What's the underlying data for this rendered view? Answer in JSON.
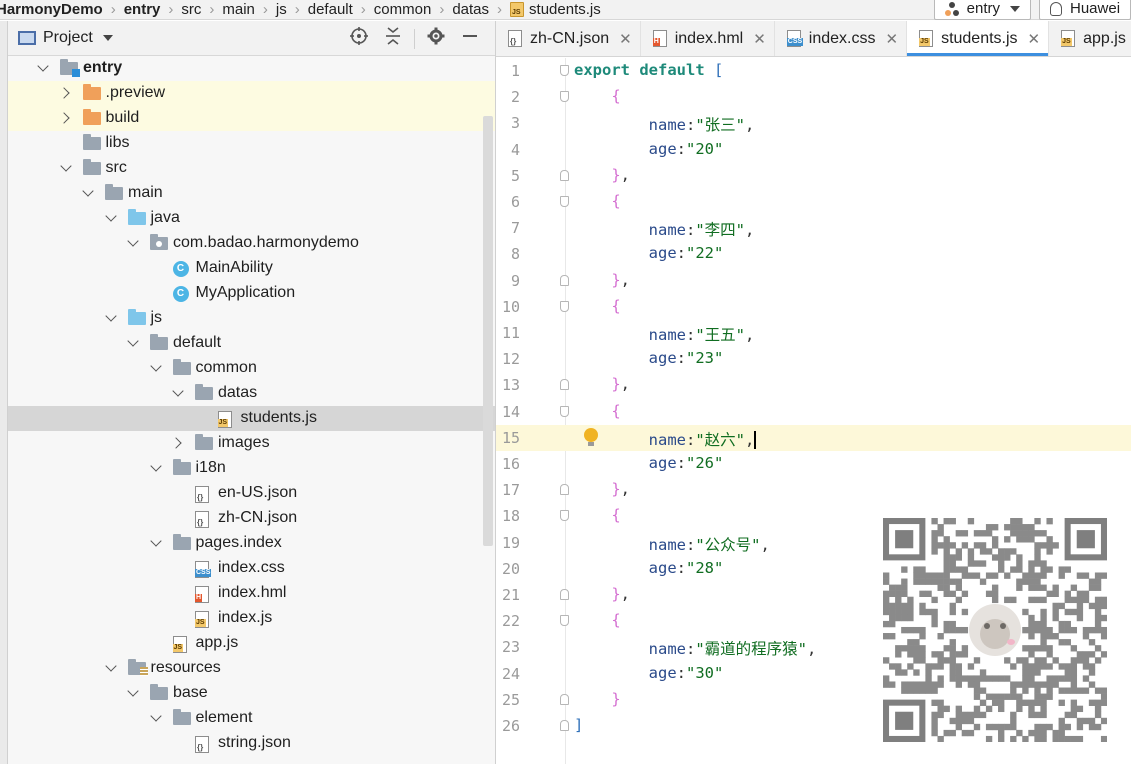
{
  "breadcrumb": {
    "items": [
      {
        "label": "HarmonyDemo",
        "bold": true
      },
      {
        "label": "entry",
        "bold": true
      },
      {
        "label": "src"
      },
      {
        "label": "main"
      },
      {
        "label": "js"
      },
      {
        "label": "default"
      },
      {
        "label": "common"
      },
      {
        "label": "datas"
      },
      {
        "label": "students.js",
        "icon": "js-file-icon"
      }
    ]
  },
  "toolbar": {
    "run_config": "entry",
    "device": "Huawei"
  },
  "project_panel": {
    "title": "Project",
    "tools": [
      "locate-icon",
      "collapse-all-icon",
      "settings-icon",
      "hide-icon"
    ]
  },
  "tree": [
    {
      "label": "entry",
      "depth": 0,
      "arrow": "down",
      "icon": "module-folder-icon",
      "bold": true
    },
    {
      "label": ".preview",
      "depth": 1,
      "arrow": "right",
      "icon": "orange-folder-icon",
      "changed": true
    },
    {
      "label": "build",
      "depth": 1,
      "arrow": "right",
      "icon": "orange-folder-icon",
      "changed": true
    },
    {
      "label": "libs",
      "depth": 1,
      "arrow": "",
      "icon": "folder-icon"
    },
    {
      "label": "src",
      "depth": 1,
      "arrow": "down",
      "icon": "folder-icon"
    },
    {
      "label": "main",
      "depth": 2,
      "arrow": "down",
      "icon": "folder-icon"
    },
    {
      "label": "java",
      "depth": 3,
      "arrow": "down",
      "icon": "blue-folder-icon"
    },
    {
      "label": "com.badao.harmonydemo",
      "depth": 4,
      "arrow": "down",
      "icon": "package-icon"
    },
    {
      "label": "MainAbility",
      "depth": 5,
      "arrow": "",
      "icon": "class-icon"
    },
    {
      "label": "MyApplication",
      "depth": 5,
      "arrow": "",
      "icon": "class-icon"
    },
    {
      "label": "js",
      "depth": 3,
      "arrow": "down",
      "icon": "blue-folder-icon"
    },
    {
      "label": "default",
      "depth": 4,
      "arrow": "down",
      "icon": "folder-icon"
    },
    {
      "label": "common",
      "depth": 5,
      "arrow": "down",
      "icon": "folder-icon"
    },
    {
      "label": "datas",
      "depth": 6,
      "arrow": "down",
      "icon": "folder-icon"
    },
    {
      "label": "students.js",
      "depth": 7,
      "arrow": "",
      "icon": "js-file-icon",
      "selected": true
    },
    {
      "label": "images",
      "depth": 6,
      "arrow": "right",
      "icon": "folder-icon"
    },
    {
      "label": "i18n",
      "depth": 5,
      "arrow": "down",
      "icon": "folder-icon"
    },
    {
      "label": "en-US.json",
      "depth": 6,
      "arrow": "",
      "icon": "json-file-icon"
    },
    {
      "label": "zh-CN.json",
      "depth": 6,
      "arrow": "",
      "icon": "json-file-icon"
    },
    {
      "label": "pages.index",
      "depth": 5,
      "arrow": "down",
      "icon": "folder-icon"
    },
    {
      "label": "index.css",
      "depth": 6,
      "arrow": "",
      "icon": "css-file-icon"
    },
    {
      "label": "index.hml",
      "depth": 6,
      "arrow": "",
      "icon": "hml-file-icon"
    },
    {
      "label": "index.js",
      "depth": 6,
      "arrow": "",
      "icon": "js-file-icon"
    },
    {
      "label": "app.js",
      "depth": 5,
      "arrow": "",
      "icon": "js-file-icon"
    },
    {
      "label": "resources",
      "depth": 3,
      "arrow": "down",
      "icon": "resources-folder-icon"
    },
    {
      "label": "base",
      "depth": 4,
      "arrow": "down",
      "icon": "folder-icon"
    },
    {
      "label": "element",
      "depth": 5,
      "arrow": "down",
      "icon": "folder-icon"
    },
    {
      "label": "string.json",
      "depth": 6,
      "arrow": "",
      "icon": "json-file-icon"
    }
  ],
  "tabs": [
    {
      "label": "zh-CN.json",
      "icon": "json-file-icon",
      "active": false,
      "closable": true
    },
    {
      "label": "index.hml",
      "icon": "hml-file-icon",
      "active": false,
      "closable": true
    },
    {
      "label": "index.css",
      "icon": "css-file-icon",
      "active": false,
      "closable": true
    },
    {
      "label": "students.js",
      "icon": "js-file-icon",
      "active": true,
      "closable": true
    },
    {
      "label": "app.js",
      "icon": "js-file-icon",
      "active": false,
      "closable": false
    }
  ],
  "editor": {
    "current_line": 15,
    "lines": [
      {
        "n": "1",
        "tokens": [
          [
            "kw2",
            "export default "
          ],
          [
            "brk",
            "["
          ]
        ],
        "fold": "start"
      },
      {
        "n": "2",
        "tokens": [
          [
            "sp",
            "    "
          ],
          [
            "brace",
            "{"
          ]
        ],
        "fold": "start"
      },
      {
        "n": "3",
        "tokens": [
          [
            "sp",
            "        "
          ],
          [
            "prop",
            "name"
          ],
          [
            "punct",
            ":"
          ],
          [
            "str",
            "\"张三\""
          ],
          [
            "punct",
            ","
          ]
        ]
      },
      {
        "n": "4",
        "tokens": [
          [
            "sp",
            "        "
          ],
          [
            "prop",
            "age"
          ],
          [
            "punct",
            ":"
          ],
          [
            "str",
            "\"20\""
          ]
        ]
      },
      {
        "n": "5",
        "tokens": [
          [
            "sp",
            "    "
          ],
          [
            "brace",
            "}"
          ],
          [
            "punct",
            ","
          ]
        ],
        "fold": "end"
      },
      {
        "n": "6",
        "tokens": [
          [
            "sp",
            "    "
          ],
          [
            "brace",
            "{"
          ]
        ],
        "fold": "start"
      },
      {
        "n": "7",
        "tokens": [
          [
            "sp",
            "        "
          ],
          [
            "prop",
            "name"
          ],
          [
            "punct",
            ":"
          ],
          [
            "str",
            "\"李四\""
          ],
          [
            "punct",
            ","
          ]
        ]
      },
      {
        "n": "8",
        "tokens": [
          [
            "sp",
            "        "
          ],
          [
            "prop",
            "age"
          ],
          [
            "punct",
            ":"
          ],
          [
            "str",
            "\"22\""
          ]
        ]
      },
      {
        "n": "9",
        "tokens": [
          [
            "sp",
            "    "
          ],
          [
            "brace",
            "}"
          ],
          [
            "punct",
            ","
          ]
        ],
        "fold": "end"
      },
      {
        "n": "10",
        "tokens": [
          [
            "sp",
            "    "
          ],
          [
            "brace",
            "{"
          ]
        ],
        "fold": "start"
      },
      {
        "n": "11",
        "tokens": [
          [
            "sp",
            "        "
          ],
          [
            "prop",
            "name"
          ],
          [
            "punct",
            ":"
          ],
          [
            "str",
            "\"王五\""
          ],
          [
            "punct",
            ","
          ]
        ]
      },
      {
        "n": "12",
        "tokens": [
          [
            "sp",
            "        "
          ],
          [
            "prop",
            "age"
          ],
          [
            "punct",
            ":"
          ],
          [
            "str",
            "\"23\""
          ]
        ]
      },
      {
        "n": "13",
        "tokens": [
          [
            "sp",
            "    "
          ],
          [
            "brace",
            "}"
          ],
          [
            "punct",
            ","
          ]
        ],
        "fold": "end"
      },
      {
        "n": "14",
        "tokens": [
          [
            "sp",
            "    "
          ],
          [
            "brace",
            "{"
          ]
        ],
        "fold": "start"
      },
      {
        "n": "15",
        "tokens": [
          [
            "sp",
            "        "
          ],
          [
            "prop",
            "name"
          ],
          [
            "punct",
            ":"
          ],
          [
            "str",
            "\"赵六\""
          ],
          [
            "punct",
            ","
          ]
        ],
        "caret": true,
        "bulb": true
      },
      {
        "n": "16",
        "tokens": [
          [
            "sp",
            "        "
          ],
          [
            "prop",
            "age"
          ],
          [
            "punct",
            ":"
          ],
          [
            "str",
            "\"26\""
          ]
        ]
      },
      {
        "n": "17",
        "tokens": [
          [
            "sp",
            "    "
          ],
          [
            "brace",
            "}"
          ],
          [
            "punct",
            ","
          ]
        ],
        "fold": "end"
      },
      {
        "n": "18",
        "tokens": [
          [
            "sp",
            "    "
          ],
          [
            "brace",
            "{"
          ]
        ],
        "fold": "start"
      },
      {
        "n": "19",
        "tokens": [
          [
            "sp",
            "        "
          ],
          [
            "prop",
            "name"
          ],
          [
            "punct",
            ":"
          ],
          [
            "str",
            "\"公众号\""
          ],
          [
            "punct",
            ","
          ]
        ]
      },
      {
        "n": "20",
        "tokens": [
          [
            "sp",
            "        "
          ],
          [
            "prop",
            "age"
          ],
          [
            "punct",
            ":"
          ],
          [
            "str",
            "\"28\""
          ]
        ]
      },
      {
        "n": "21",
        "tokens": [
          [
            "sp",
            "    "
          ],
          [
            "brace",
            "}"
          ],
          [
            "punct",
            ","
          ]
        ],
        "fold": "end"
      },
      {
        "n": "22",
        "tokens": [
          [
            "sp",
            "    "
          ],
          [
            "brace",
            "{"
          ]
        ],
        "fold": "start"
      },
      {
        "n": "23",
        "tokens": [
          [
            "sp",
            "        "
          ],
          [
            "prop",
            "name"
          ],
          [
            "punct",
            ":"
          ],
          [
            "str",
            "\"霸道的程序猿\""
          ],
          [
            "punct",
            ","
          ]
        ]
      },
      {
        "n": "24",
        "tokens": [
          [
            "sp",
            "        "
          ],
          [
            "prop",
            "age"
          ],
          [
            "punct",
            ":"
          ],
          [
            "str",
            "\"30\""
          ]
        ]
      },
      {
        "n": "25",
        "tokens": [
          [
            "sp",
            "    "
          ],
          [
            "brace",
            "}"
          ]
        ],
        "fold": "end"
      },
      {
        "n": "26",
        "tokens": [
          [
            "brk",
            "]"
          ]
        ],
        "fold": "end"
      }
    ]
  },
  "colors": {
    "accent": "#3d8fdf",
    "changed_row": "#fdfbe1",
    "selected_row": "#d6d6d6",
    "current_line": "#fdf8d9"
  }
}
